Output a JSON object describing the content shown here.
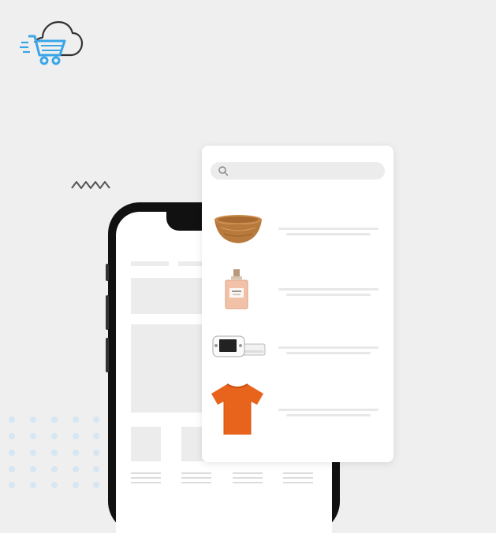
{
  "logo": {
    "icon": "cloud-cart-icon",
    "accent": "#3aa6e8",
    "outline": "#333333"
  },
  "search": {
    "placeholder": "",
    "icon": "search-icon"
  },
  "products": [
    {
      "name": "wooden-bowl",
      "icon": "wooden-bowl-image"
    },
    {
      "name": "perfume-bottle",
      "icon": "perfume-bottle-image"
    },
    {
      "name": "game-console",
      "icon": "game-console-image"
    },
    {
      "name": "orange-tshirt",
      "icon": "orange-tshirt-image"
    }
  ],
  "colors": {
    "background": "#efefef",
    "dots": "#d6e6f2",
    "tshirt": "#e8641c",
    "wood": "#b87a3c"
  }
}
